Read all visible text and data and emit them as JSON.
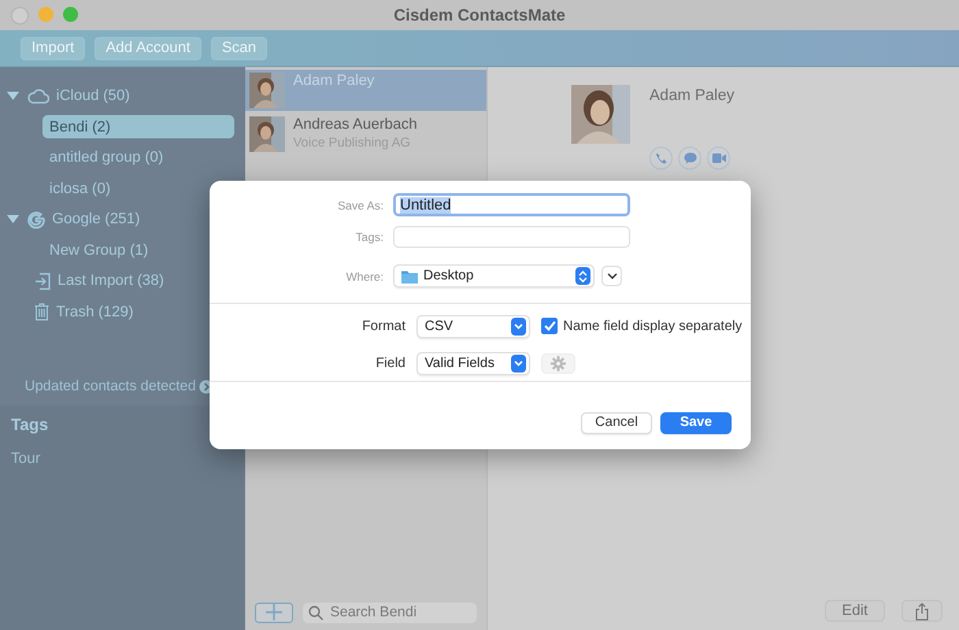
{
  "window": {
    "title": "Cisdem ContactsMate"
  },
  "toolbar": {
    "buttons": [
      "Import",
      "Add Account",
      "Scan"
    ]
  },
  "sidebar": {
    "items": [
      {
        "kind": "account",
        "label": "iCloud (50)",
        "expanded": true,
        "selected": false,
        "children": [
          {
            "label": "Bendi (2)",
            "selected": true
          },
          {
            "label": "antitled group (0)",
            "selected": false
          },
          {
            "label": "iclosa (0)",
            "selected": false
          }
        ]
      },
      {
        "kind": "account",
        "label": "Google (251)",
        "expanded": true,
        "selected": false,
        "children": [
          {
            "label": "New Group (1)",
            "selected": false
          }
        ]
      },
      {
        "kind": "special",
        "label": "Last Import (38)",
        "selected": false
      },
      {
        "kind": "special",
        "label": "Trash (129)",
        "selected": false
      }
    ],
    "notice": "Updated contacts detected",
    "tags_heading": "Tags",
    "tags": [
      "Tour"
    ]
  },
  "contacts": [
    {
      "name": "Adam Paley",
      "selected": true
    },
    {
      "name": "Andreas Auerbach",
      "company": "Voice Publishing AG",
      "selected": false
    }
  ],
  "list_footer": {
    "search_placeholder": "Search Bendi"
  },
  "detail": {
    "name": "Adam Paley",
    "edit_button": "Edit"
  },
  "dialog": {
    "save_as_label": "Save As:",
    "save_as_value": "Untitled",
    "tags_label": "Tags:",
    "where_label": "Where:",
    "where_value": "Desktop",
    "format_label": "Format",
    "format_value": "CSV",
    "separate_checkbox": {
      "label": "Name field display separately",
      "checked": true
    },
    "field_label": "Field",
    "field_value": "Valid Fields",
    "buttons": [
      "Cancel",
      "Save"
    ]
  }
}
